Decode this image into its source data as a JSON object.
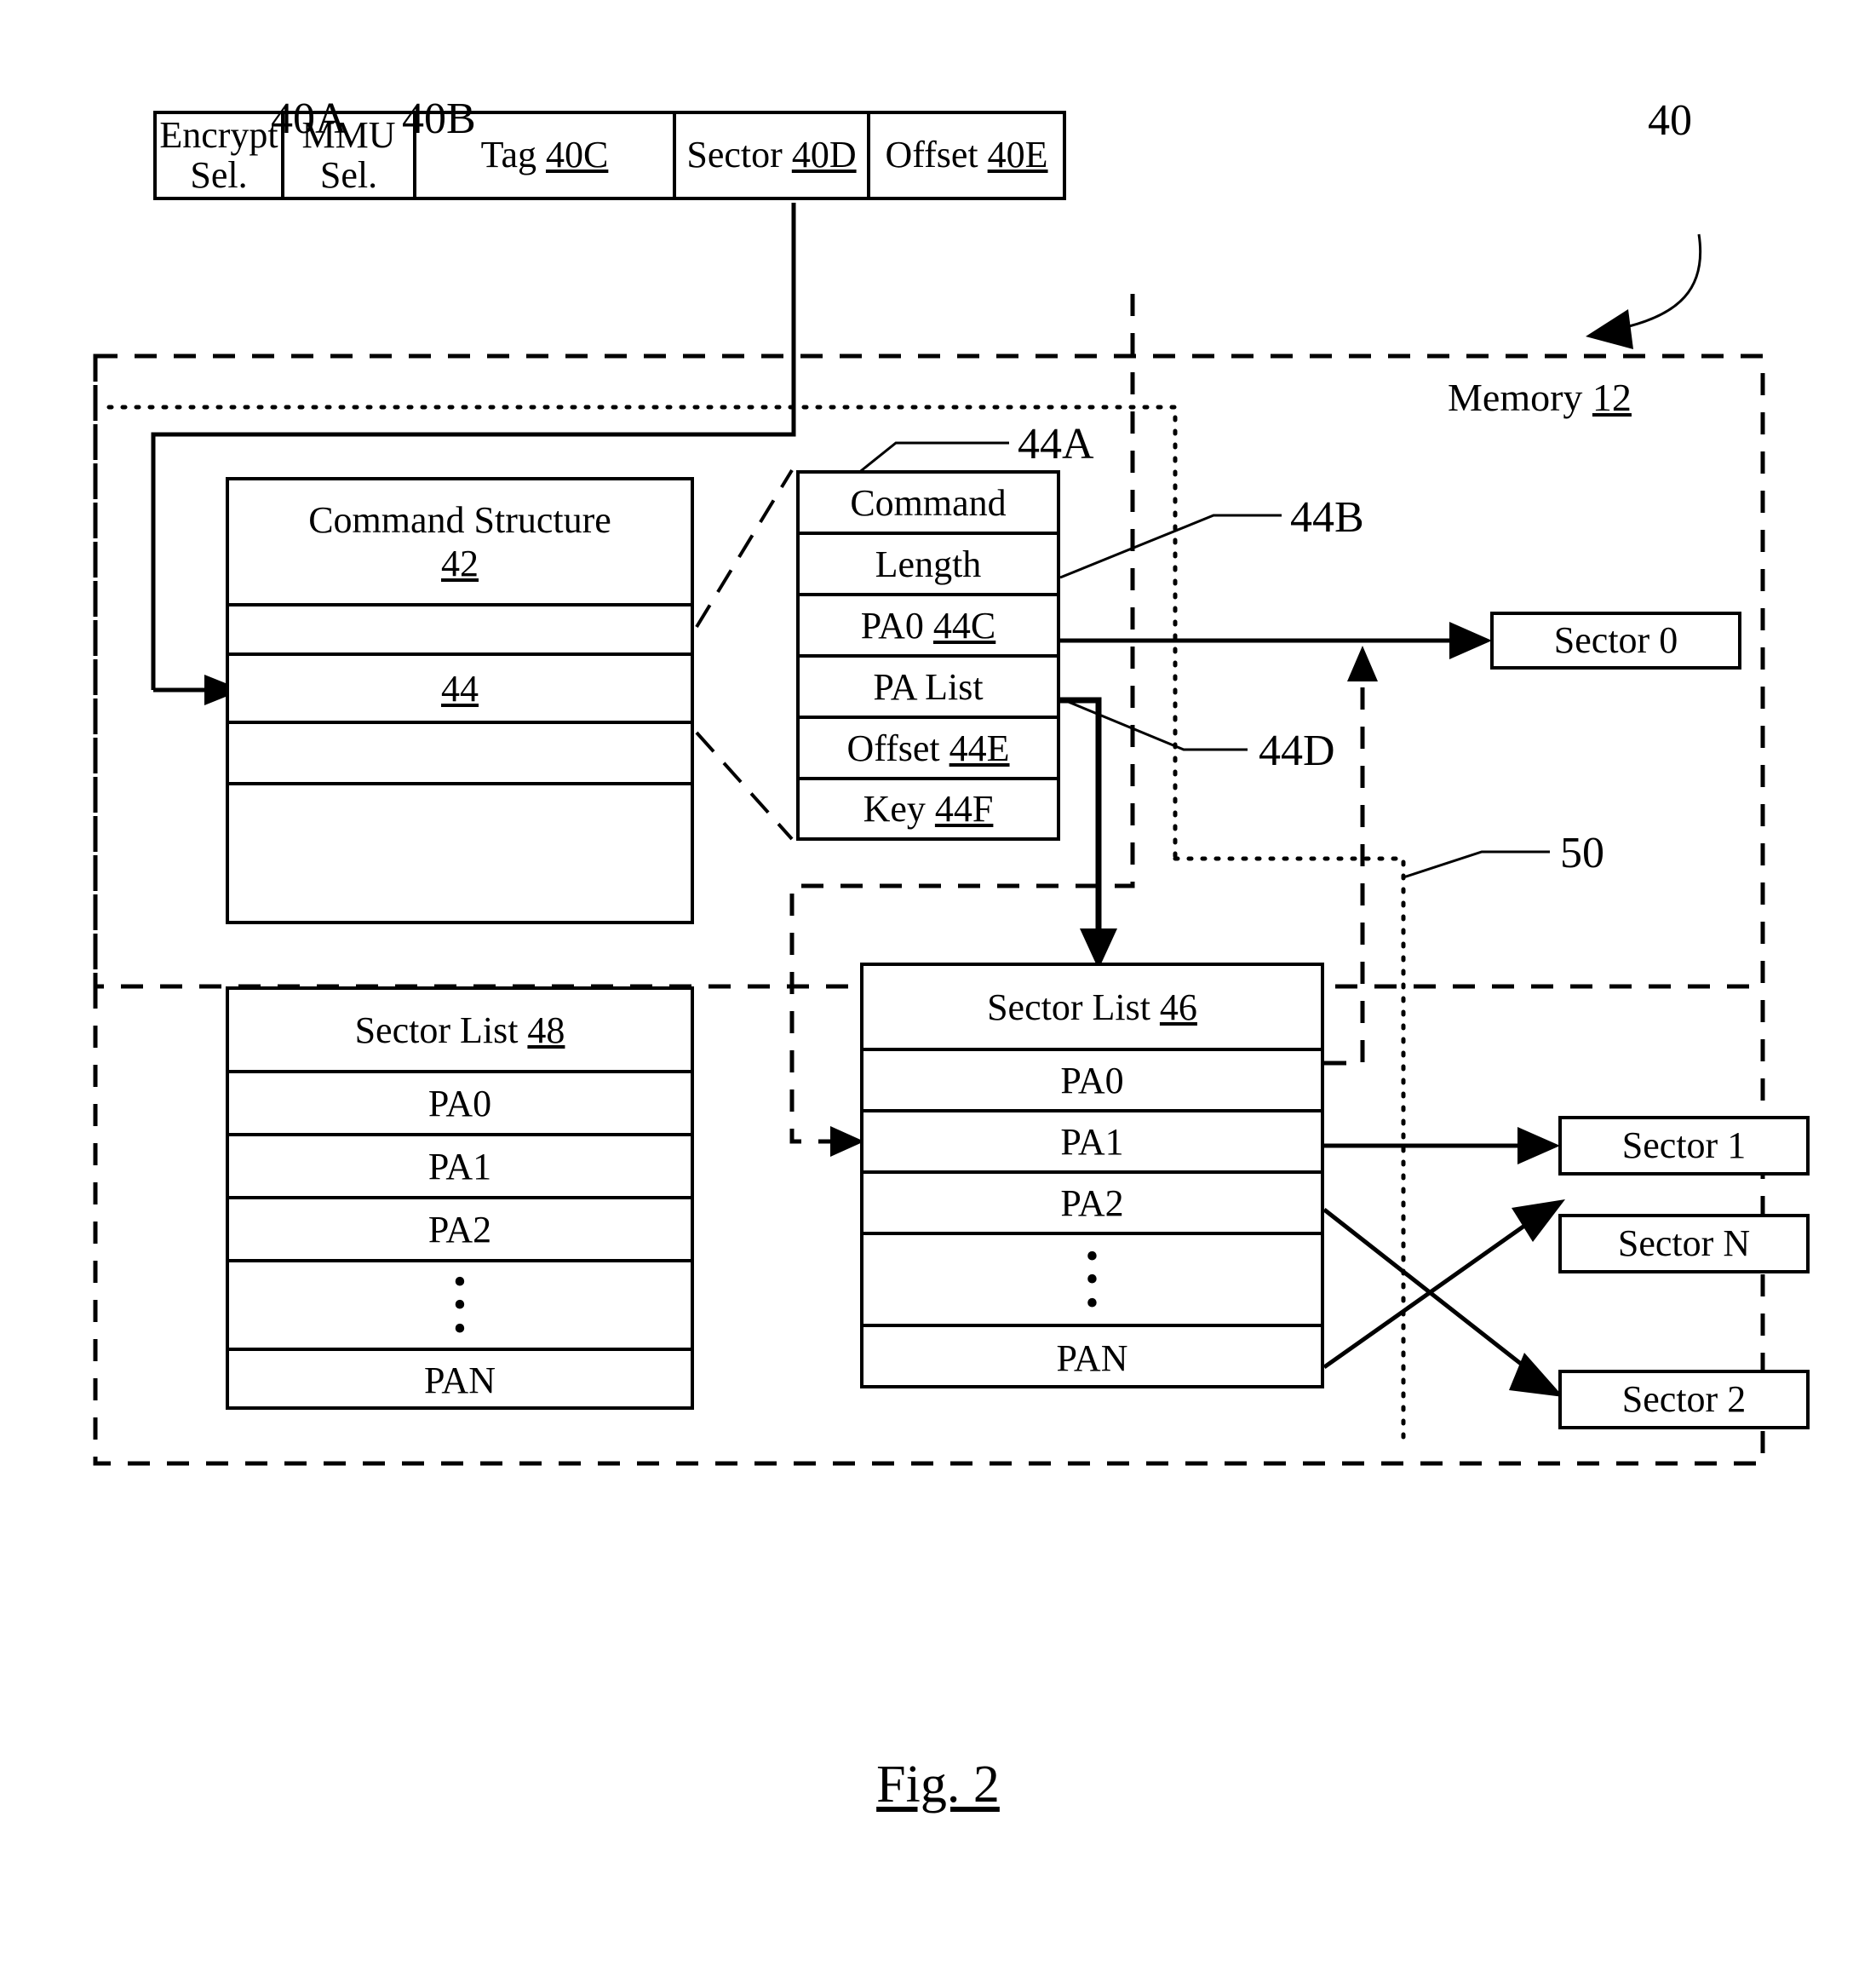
{
  "figure": {
    "caption_prefix": "Fig.",
    "caption_number": "2",
    "caption": "Fig. 2"
  },
  "header_register": {
    "ref": "40",
    "cells": [
      {
        "label_line1": "Encrypt",
        "label_line2": "Sel.",
        "ref": "40A"
      },
      {
        "label_line1": "MMU",
        "label_line2": "Sel.",
        "ref": "40B"
      },
      {
        "label": "Tag",
        "ref": "40C"
      },
      {
        "label": "Sector",
        "ref": "40D"
      },
      {
        "label": "Offset",
        "ref": "40E"
      }
    ]
  },
  "memory": {
    "label": "Memory",
    "ref": "12"
  },
  "command_structure": {
    "title": "Command Structure",
    "ref": "42",
    "rows": [
      "",
      "44",
      "",
      ""
    ],
    "highlight_row_ref": "44"
  },
  "command_descriptor": {
    "ref": "44A",
    "rows": [
      {
        "label": "Command",
        "ref": ""
      },
      {
        "label": "Length",
        "ref": ""
      },
      {
        "label": "PA0",
        "ref": "44C"
      },
      {
        "label": "PA List",
        "ref": ""
      },
      {
        "label": "Offset",
        "ref": "44E"
      },
      {
        "label": "Key",
        "ref": "44F"
      }
    ],
    "callouts": [
      {
        "ref": "44B",
        "points_to": "Length"
      },
      {
        "ref": "44D",
        "points_to": "PA List"
      }
    ]
  },
  "sector_list_48": {
    "title": "Sector List",
    "ref": "48",
    "entries": [
      "PA0",
      "PA1",
      "PA2",
      "⋮",
      "PAN"
    ]
  },
  "sector_list_46": {
    "title": "Sector List",
    "ref": "46",
    "entries": [
      "PA0",
      "PA1",
      "PA2",
      "⋮",
      "PAN"
    ]
  },
  "sectors": [
    {
      "label": "Sector 0"
    },
    {
      "label": "Sector 1"
    },
    {
      "label": "Sector N"
    },
    {
      "label": "Sector 2"
    }
  ],
  "callout_50": {
    "ref": "50"
  },
  "colors": {
    "ink": "#000000",
    "paper": "#ffffff"
  }
}
